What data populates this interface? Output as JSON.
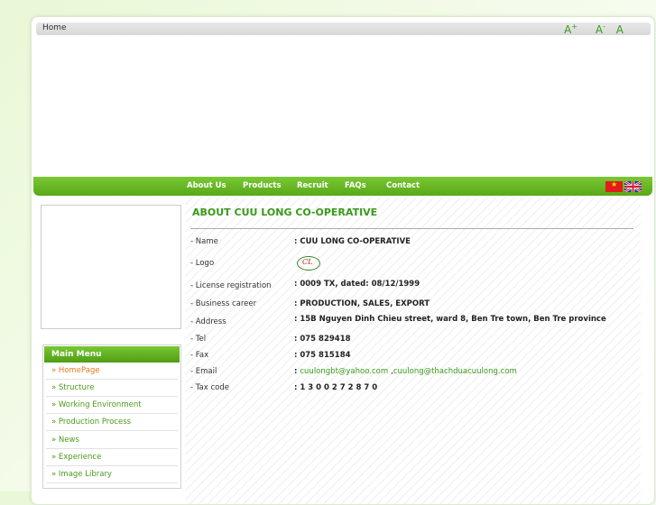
{
  "topbar": {
    "home": "Home",
    "font_increase": "A",
    "font_increase_sup": "+",
    "font_decrease": "A",
    "font_decrease_sup": "-",
    "font_reset": "A"
  },
  "nav": {
    "items": [
      "About Us",
      "Products",
      "Recruit",
      "FAQs",
      "Contact"
    ],
    "languages": [
      "vn-flag-icon",
      "uk-flag-icon"
    ]
  },
  "menu": {
    "title": "Main Menu",
    "items": [
      {
        "label": "» HomePage",
        "active": true
      },
      {
        "label": "» Structure",
        "active": false
      },
      {
        "label": "» Working Environment",
        "active": false
      },
      {
        "label": "» Production Process",
        "active": false
      },
      {
        "label": "» News",
        "active": false
      },
      {
        "label": "» Experience",
        "active": false
      },
      {
        "label": "» Image Library",
        "active": false
      }
    ]
  },
  "content": {
    "title": "ABOUT CUU LONG CO-OPERATIVE",
    "rows": [
      {
        "label": "- Name",
        "value": ": CUU LONG CO-OPERATIVE"
      },
      {
        "label": "- Logo",
        "value": ""
      },
      {
        "label": "- License registration",
        "value": ": 0009 TX, dated: 08/12/1999"
      },
      {
        "label": "- Business career",
        "value": ": PRODUCTION, SALES, EXPORT"
      },
      {
        "label": "- Address",
        "value": ": 15B Nguyen Dinh Chieu street, ward 8, Ben Tre town, Ben Tre province"
      },
      {
        "label": "- Tel",
        "value": ": 075 829418"
      },
      {
        "label": "- Fax",
        "value": ": 075 815184"
      },
      {
        "label": "- Email",
        "value": ":"
      },
      {
        "label": "- Tax code",
        "value": ": 1 3 0 0 2 7 2 8 7 0"
      }
    ],
    "email_1": "cuulongbt@yahoo.com",
    "email_sep": ",",
    "email_2": "cuulong@thachduacuulong.com"
  },
  "colors": {
    "accent": "#5aaa1c",
    "active_menu": "#e8781c"
  }
}
